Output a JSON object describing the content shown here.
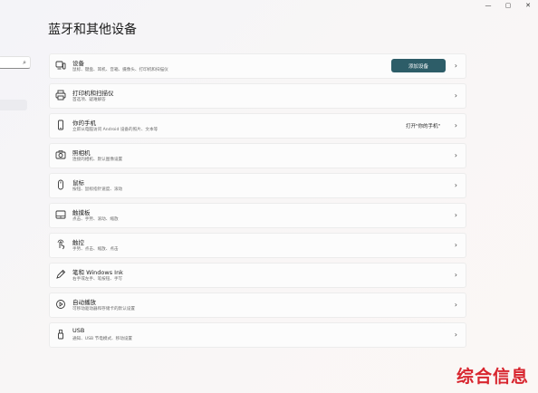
{
  "window": {
    "minimize": "—",
    "maximize": "▢",
    "close": "✕"
  },
  "page": {
    "title": "蓝牙和其他设备"
  },
  "sidebar": {
    "search_icon": "⌕"
  },
  "items": [
    {
      "icon": "devices-icon",
      "title": "设备",
      "subtitle": "鼠标、键盘、耳机、音箱、摄像头、打印机和扫描仪",
      "button": "添加设备"
    },
    {
      "icon": "printer-icon",
      "title": "打印机和扫描仪",
      "subtitle": "首选项、疑难解答"
    },
    {
      "icon": "phone-icon",
      "title": "你的手机",
      "subtitle": "立即从电脑访问 Android 设备的照片、文本等",
      "link": "打开\"你的手机\""
    },
    {
      "icon": "camera-icon",
      "title": "照相机",
      "subtitle": "连接的相机、默认图像设置"
    },
    {
      "icon": "mouse-icon",
      "title": "鼠标",
      "subtitle": "按钮、鼠标指针速度、滚动"
    },
    {
      "icon": "touchpad-icon",
      "title": "触摸板",
      "subtitle": "点击、手势、滚动、缩放"
    },
    {
      "icon": "touch-icon",
      "title": "触控",
      "subtitle": "手势、点击、缩放、点击"
    },
    {
      "icon": "pen-icon",
      "title": "笔和 Windows Ink",
      "subtitle": "右手或左手、笔按钮、手写"
    },
    {
      "icon": "autoplay-icon",
      "title": "自动播放",
      "subtitle": "可移动驱动器和存储卡的默认设置"
    },
    {
      "icon": "usb-icon",
      "title": "USB",
      "subtitle": "通知、USB 节电模式、移动设置"
    }
  ],
  "chevron": "›",
  "watermark": "综合信息"
}
